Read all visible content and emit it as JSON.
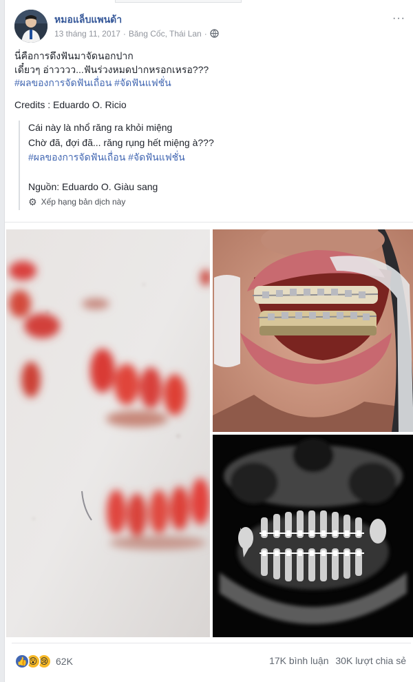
{
  "post": {
    "author": "หมอแล็บแพนด้า",
    "date": "13 tháng 11, 2017",
    "location": "Băng Cốc, Thái Lan",
    "more_label": "···",
    "lines": [
      "นี่คือการดึงฟันมาจัดนอกปาก",
      "เดี๋ยวๆ อ่าวววว...ฟันร่วงหมดปากหรอกเหรอ???"
    ],
    "hashtags": "#ผลของการจัดฟันเถื่อน #จัดฟันแฟชั่น",
    "credits": "Credits : Eduardo O. Ricio"
  },
  "translation": {
    "line1": "Cái này là nhổ răng ra khỏi miệng",
    "line2": "Chờ đã, đợi đã... răng rụng hết miệng à???",
    "hashtags": "#ผลของการจัดฟันเถื่อน #จัดฟันแฟชั่น",
    "source": "Nguồn: Eduardo O. Giàu sang",
    "rate_label": "Xếp hạng bản dịch này"
  },
  "engagement": {
    "reaction_count": "62K",
    "comments": "17K bình luận",
    "shares": "30K lượt chia sẻ"
  },
  "icons": {
    "like": "like-icon",
    "wow": "wow-icon",
    "sad": "sad-icon",
    "globe": "globe-icon",
    "gear": "gear-icon"
  },
  "colors": {
    "link": "#365899",
    "hashtag": "#4267b2",
    "muted": "#90949c"
  }
}
